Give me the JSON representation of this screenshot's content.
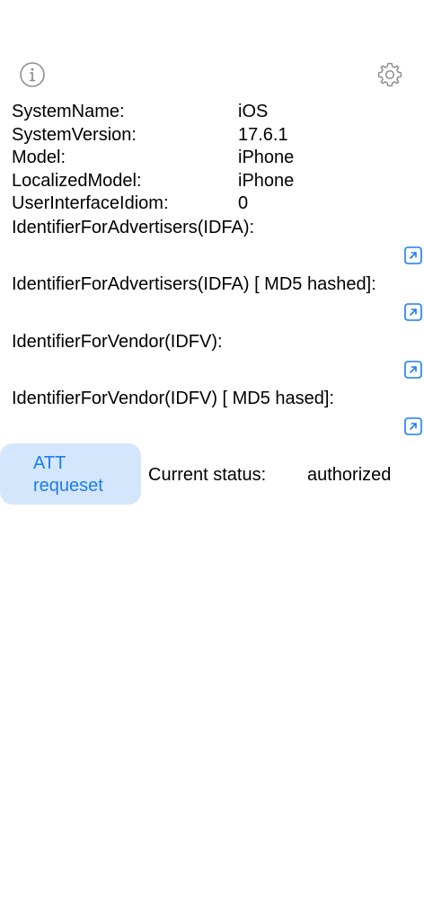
{
  "icons": {
    "info": "info-circle-icon",
    "settings": "gear-icon",
    "link": "arrow-up-right-square-icon"
  },
  "colors": {
    "accent": "#1a7cf3",
    "button_bg": "#d4e6fb",
    "icon_gray": "#8e8e93"
  },
  "device_info": [
    {
      "key": "SystemName:",
      "value": "iOS"
    },
    {
      "key": "SystemVersion:",
      "value": "17.6.1"
    },
    {
      "key": "Model:",
      "value": "iPhone"
    },
    {
      "key": "LocalizedModel:",
      "value": "iPhone"
    },
    {
      "key": "UserInterfaceIdiom:",
      "value": "0"
    }
  ],
  "identifiers": {
    "idfa_label": "IdentifierForAdvertisers(IDFA):",
    "idfa_md5_label": "IdentifierForAdvertisers(IDFA) [ MD5 hashed]:",
    "idfv_label": "IdentifierForVendor(IDFV):",
    "idfv_md5_label": "IdentifierForVendor(IDFV) [ MD5 hased]:"
  },
  "att": {
    "button_line1": "ATT",
    "button_line2": "requeset",
    "status_label": "Current status:",
    "status_value": "authorized"
  }
}
